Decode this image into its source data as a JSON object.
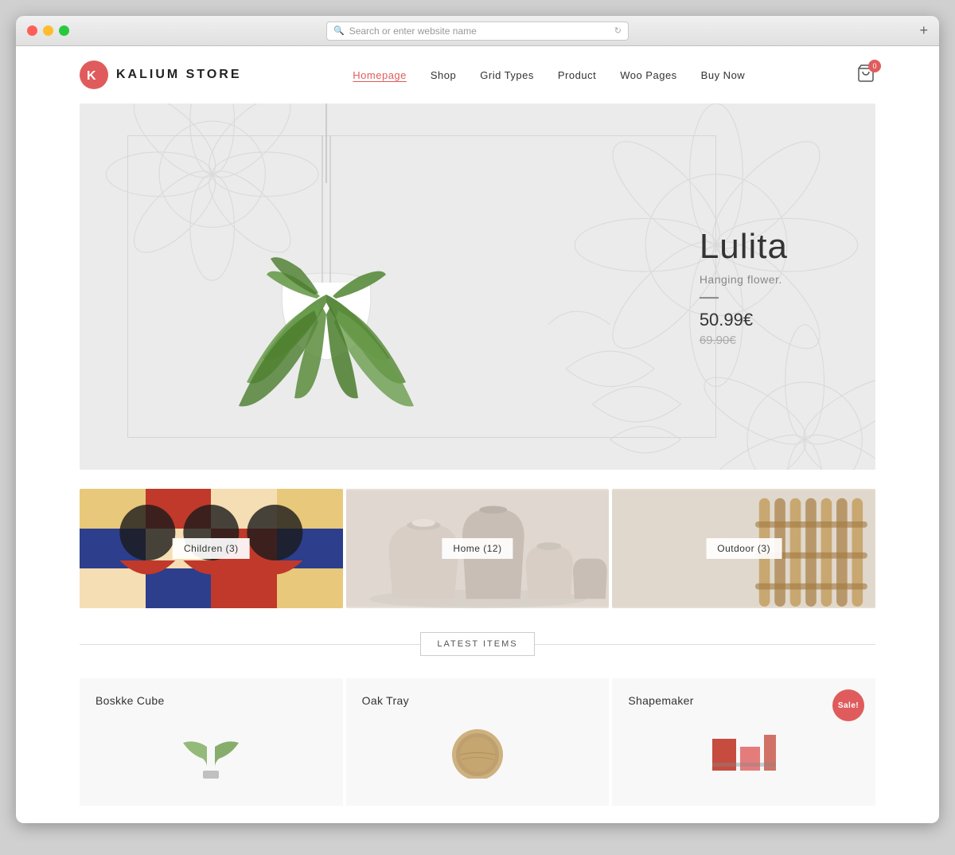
{
  "browser": {
    "address_placeholder": "Search or enter website name",
    "new_tab_label": "+"
  },
  "site": {
    "logo_text": "KALIUM STORE",
    "nav": [
      {
        "label": "Homepage",
        "active": true
      },
      {
        "label": "Shop",
        "active": false
      },
      {
        "label": "Grid Types",
        "active": false
      },
      {
        "label": "Product",
        "active": false
      },
      {
        "label": "Woo Pages",
        "active": false
      },
      {
        "label": "Buy Now",
        "active": false
      }
    ],
    "cart_count": "0"
  },
  "hero": {
    "product_name": "Lulita",
    "subtitle": "Hanging flower.",
    "price_new": "50.99€",
    "price_old": "69.90€"
  },
  "categories": [
    {
      "label": "Children (3)"
    },
    {
      "label": "Home (12)"
    },
    {
      "label": "Outdoor (3)"
    }
  ],
  "latest_section": {
    "title": "LATEST ITEMS"
  },
  "products": [
    {
      "title": "Boskke Cube",
      "sale": false
    },
    {
      "title": "Oak Tray",
      "sale": false
    },
    {
      "title": "Shapemaker",
      "sale": true,
      "sale_label": "Sale!"
    }
  ]
}
